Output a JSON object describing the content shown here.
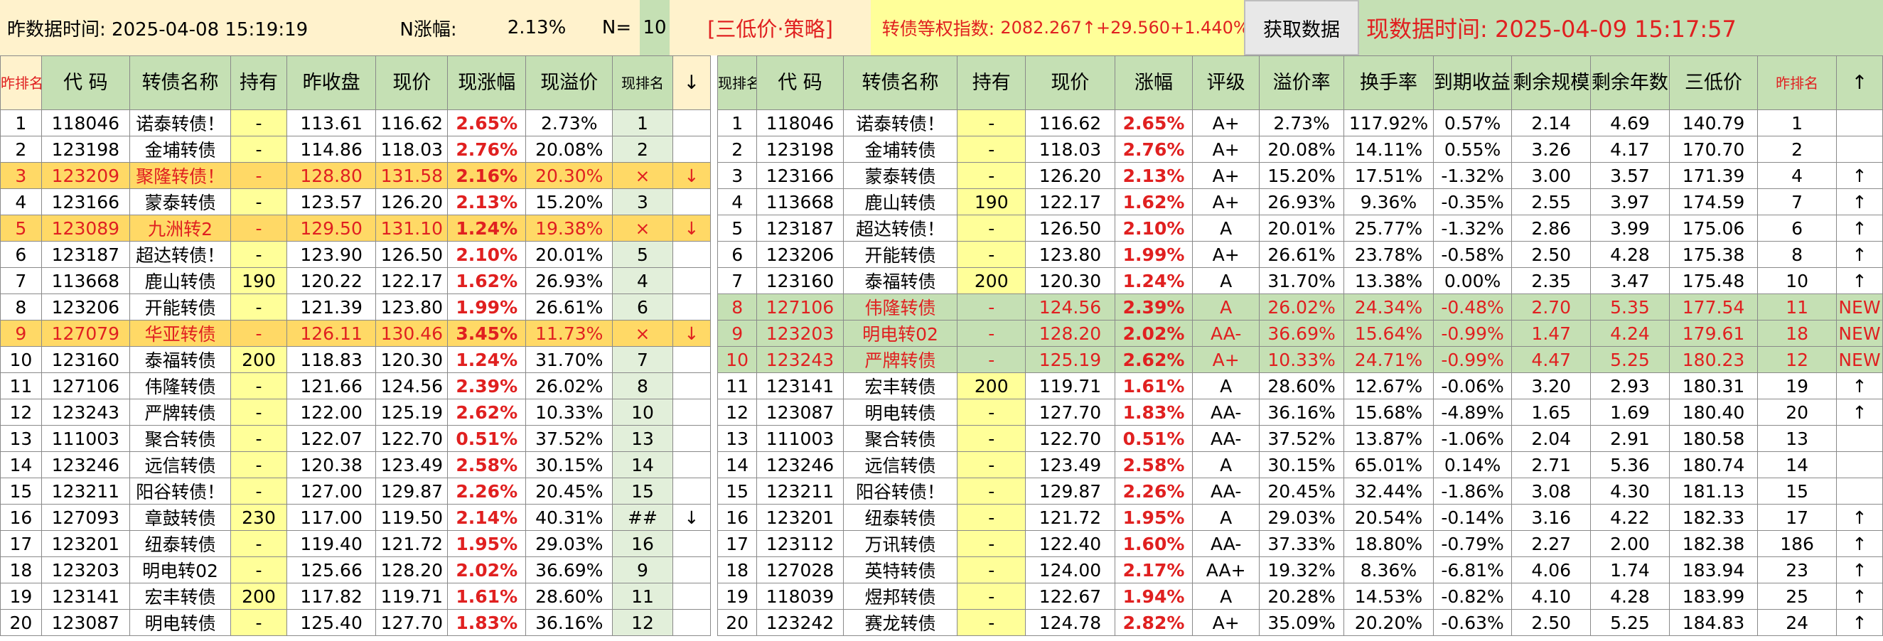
{
  "toolbar": {
    "prev_time_label": "昨数据时间: 2025-04-08 15:19:19",
    "n_change_label": "N涨幅:",
    "n_change_value": "2.13%",
    "n_label": "N=",
    "n_value": "10",
    "strategy_label": "[三低价·策略]",
    "index_label": "转债等权指数:",
    "index_value": "2082.267↑+29.560+1.440%",
    "fetch_button": "获取数据",
    "curr_time_label": "现数据时间: 2025-04-09 15:17:57"
  },
  "colors": {
    "up": "#e02020",
    "header_bg": "#c5e0b4",
    "hold_bg": "#ffff99",
    "drop_row_bg": "#ffd966"
  },
  "left_table": {
    "headers": {
      "rank": "昨排名",
      "code": "代 码",
      "name": "转债名称",
      "hold": "持有",
      "prev_close": "昨收盘",
      "price": "现价",
      "change": "现涨幅",
      "premium": "现溢价",
      "now_rank": "现排名",
      "arrow": "↓"
    },
    "rows": [
      {
        "rank": "1",
        "code": "118046",
        "name": "诺泰转债！",
        "hold": "-",
        "prev": "113.61",
        "price": "116.62",
        "chg": "2.65%",
        "prem": "2.73%",
        "now": "1",
        "arrow": "",
        "style": ""
      },
      {
        "rank": "2",
        "code": "123198",
        "name": "金埔转债",
        "hold": "-",
        "prev": "114.86",
        "price": "118.03",
        "chg": "2.76%",
        "prem": "20.08%",
        "now": "2",
        "arrow": "",
        "style": ""
      },
      {
        "rank": "3",
        "code": "123209",
        "name": "聚隆转债！",
        "hold": "-",
        "prev": "128.80",
        "price": "131.58",
        "chg": "2.16%",
        "prem": "20.30%",
        "now": "×",
        "arrow": "↓",
        "style": "drop"
      },
      {
        "rank": "4",
        "code": "123166",
        "name": "蒙泰转债",
        "hold": "-",
        "prev": "123.57",
        "price": "126.20",
        "chg": "2.13%",
        "prem": "15.20%",
        "now": "3",
        "arrow": "",
        "style": ""
      },
      {
        "rank": "5",
        "code": "123089",
        "name": "九洲转2",
        "hold": "-",
        "prev": "129.50",
        "price": "131.10",
        "chg": "1.24%",
        "prem": "19.38%",
        "now": "×",
        "arrow": "↓",
        "style": "drop"
      },
      {
        "rank": "6",
        "code": "123187",
        "name": "超达转债！",
        "hold": "-",
        "prev": "123.90",
        "price": "126.50",
        "chg": "2.10%",
        "prem": "20.01%",
        "now": "5",
        "arrow": "",
        "style": ""
      },
      {
        "rank": "7",
        "code": "113668",
        "name": "鹿山转债",
        "hold": "190",
        "prev": "120.22",
        "price": "122.17",
        "chg": "1.62%",
        "prem": "26.93%",
        "now": "4",
        "arrow": "",
        "style": ""
      },
      {
        "rank": "8",
        "code": "123206",
        "name": "开能转债",
        "hold": "-",
        "prev": "121.39",
        "price": "123.80",
        "chg": "1.99%",
        "prem": "26.61%",
        "now": "6",
        "arrow": "",
        "style": ""
      },
      {
        "rank": "9",
        "code": "127079",
        "name": "华亚转债",
        "hold": "-",
        "prev": "126.11",
        "price": "130.46",
        "chg": "3.45%",
        "prem": "11.73%",
        "now": "×",
        "arrow": "↓",
        "style": "drop"
      },
      {
        "rank": "10",
        "code": "123160",
        "name": "泰福转债",
        "hold": "200",
        "prev": "118.83",
        "price": "120.30",
        "chg": "1.24%",
        "prem": "31.70%",
        "now": "7",
        "arrow": "",
        "style": ""
      },
      {
        "rank": "11",
        "code": "127106",
        "name": "伟隆转债",
        "hold": "-",
        "prev": "121.66",
        "price": "124.56",
        "chg": "2.39%",
        "prem": "26.02%",
        "now": "8",
        "arrow": "",
        "style": ""
      },
      {
        "rank": "12",
        "code": "123243",
        "name": "严牌转债",
        "hold": "-",
        "prev": "122.00",
        "price": "125.19",
        "chg": "2.62%",
        "prem": "10.33%",
        "now": "10",
        "arrow": "",
        "style": ""
      },
      {
        "rank": "13",
        "code": "111003",
        "name": "聚合转债",
        "hold": "-",
        "prev": "122.07",
        "price": "122.70",
        "chg": "0.51%",
        "prem": "37.52%",
        "now": "13",
        "arrow": "",
        "style": ""
      },
      {
        "rank": "14",
        "code": "123246",
        "name": "远信转债",
        "hold": "-",
        "prev": "120.38",
        "price": "123.49",
        "chg": "2.58%",
        "prem": "30.15%",
        "now": "14",
        "arrow": "",
        "style": ""
      },
      {
        "rank": "15",
        "code": "123211",
        "name": "阳谷转债！",
        "hold": "-",
        "prev": "127.00",
        "price": "129.87",
        "chg": "2.26%",
        "prem": "20.45%",
        "now": "15",
        "arrow": "",
        "style": ""
      },
      {
        "rank": "16",
        "code": "127093",
        "name": "章鼓转债",
        "hold": "230",
        "prev": "117.00",
        "price": "119.50",
        "chg": "2.14%",
        "prem": "40.31%",
        "now": "##",
        "arrow": "↓",
        "style": ""
      },
      {
        "rank": "17",
        "code": "123201",
        "name": "纽泰转债",
        "hold": "-",
        "prev": "119.40",
        "price": "121.72",
        "chg": "1.95%",
        "prem": "29.03%",
        "now": "16",
        "arrow": "",
        "style": ""
      },
      {
        "rank": "18",
        "code": "123203",
        "name": "明电转02",
        "hold": "-",
        "prev": "125.66",
        "price": "128.20",
        "chg": "2.02%",
        "prem": "36.69%",
        "now": "9",
        "arrow": "",
        "style": ""
      },
      {
        "rank": "19",
        "code": "123141",
        "name": "宏丰转债",
        "hold": "200",
        "prev": "117.82",
        "price": "119.71",
        "chg": "1.61%",
        "prem": "28.60%",
        "now": "11",
        "arrow": "",
        "style": ""
      },
      {
        "rank": "20",
        "code": "123087",
        "name": "明电转债",
        "hold": "-",
        "prev": "125.40",
        "price": "127.70",
        "chg": "1.83%",
        "prem": "36.16%",
        "now": "12",
        "arrow": "",
        "style": ""
      }
    ]
  },
  "right_table": {
    "headers": {
      "rank": "现排名",
      "code": "代 码",
      "name": "转债名称",
      "hold": "持有",
      "price": "现价",
      "change": "涨幅",
      "rating": "评级",
      "premium": "溢价率",
      "turnover": "换手率",
      "ytm": "到期收益率",
      "scale": "剩余规模",
      "years": "剩余年数",
      "triple_low": "三低价",
      "prev_rank": "昨排名",
      "arrow": "↑"
    },
    "rows": [
      {
        "rank": "1",
        "code": "118046",
        "name": "诺泰转债！",
        "hold": "-",
        "price": "116.62",
        "chg": "2.65%",
        "rating": "A+",
        "prem": "2.73%",
        "turn": "117.92%",
        "ytm": "0.57%",
        "scale": "2.14",
        "years": "4.69",
        "tl": "140.79",
        "prev": "1",
        "arrow": "",
        "style": ""
      },
      {
        "rank": "2",
        "code": "123198",
        "name": "金埔转债",
        "hold": "-",
        "price": "118.03",
        "chg": "2.76%",
        "rating": "A+",
        "prem": "20.08%",
        "turn": "14.11%",
        "ytm": "0.55%",
        "scale": "3.26",
        "years": "4.17",
        "tl": "170.70",
        "prev": "2",
        "arrow": "",
        "style": ""
      },
      {
        "rank": "3",
        "code": "123166",
        "name": "蒙泰转债",
        "hold": "-",
        "price": "126.20",
        "chg": "2.13%",
        "rating": "A+",
        "prem": "15.20%",
        "turn": "17.51%",
        "ytm": "-1.32%",
        "scale": "3.00",
        "years": "3.57",
        "tl": "171.39",
        "prev": "4",
        "arrow": "↑",
        "style": ""
      },
      {
        "rank": "4",
        "code": "113668",
        "name": "鹿山转债",
        "hold": "190",
        "price": "122.17",
        "chg": "1.62%",
        "rating": "A+",
        "prem": "26.93%",
        "turn": "9.36%",
        "ytm": "-0.35%",
        "scale": "2.55",
        "years": "3.97",
        "tl": "174.59",
        "prev": "7",
        "arrow": "↑",
        "style": ""
      },
      {
        "rank": "5",
        "code": "123187",
        "name": "超达转债！",
        "hold": "-",
        "price": "126.50",
        "chg": "2.10%",
        "rating": "A",
        "prem": "20.01%",
        "turn": "25.77%",
        "ytm": "-1.32%",
        "scale": "2.86",
        "years": "3.99",
        "tl": "175.06",
        "prev": "6",
        "arrow": "↑",
        "style": ""
      },
      {
        "rank": "6",
        "code": "123206",
        "name": "开能转债",
        "hold": "-",
        "price": "123.80",
        "chg": "1.99%",
        "rating": "A+",
        "prem": "26.61%",
        "turn": "23.78%",
        "ytm": "-0.58%",
        "scale": "2.50",
        "years": "4.28",
        "tl": "175.38",
        "prev": "8",
        "arrow": "↑",
        "style": ""
      },
      {
        "rank": "7",
        "code": "123160",
        "name": "泰福转债",
        "hold": "200",
        "price": "120.30",
        "chg": "1.24%",
        "rating": "A",
        "prem": "31.70%",
        "turn": "13.38%",
        "ytm": "0.00%",
        "scale": "2.35",
        "years": "3.47",
        "tl": "175.48",
        "prev": "10",
        "arrow": "↑",
        "style": ""
      },
      {
        "rank": "8",
        "code": "127106",
        "name": "伟隆转债",
        "hold": "-",
        "price": "124.56",
        "chg": "2.39%",
        "rating": "A",
        "prem": "26.02%",
        "turn": "24.34%",
        "ytm": "-0.48%",
        "scale": "2.70",
        "years": "5.35",
        "tl": "177.54",
        "prev": "11",
        "arrow": "NEW",
        "style": "newin"
      },
      {
        "rank": "9",
        "code": "123203",
        "name": "明电转02",
        "hold": "-",
        "price": "128.20",
        "chg": "2.02%",
        "rating": "AA-",
        "prem": "36.69%",
        "turn": "15.64%",
        "ytm": "-0.99%",
        "scale": "1.47",
        "years": "4.24",
        "tl": "179.61",
        "prev": "18",
        "arrow": "NEW",
        "style": "newin"
      },
      {
        "rank": "10",
        "code": "123243",
        "name": "严牌转债",
        "hold": "-",
        "price": "125.19",
        "chg": "2.62%",
        "rating": "A+",
        "prem": "10.33%",
        "turn": "24.71%",
        "ytm": "-0.99%",
        "scale": "4.47",
        "years": "5.25",
        "tl": "180.23",
        "prev": "12",
        "arrow": "NEW",
        "style": "newin"
      },
      {
        "rank": "11",
        "code": "123141",
        "name": "宏丰转债",
        "hold": "200",
        "price": "119.71",
        "chg": "1.61%",
        "rating": "A",
        "prem": "28.60%",
        "turn": "12.67%",
        "ytm": "-0.06%",
        "scale": "3.20",
        "years": "2.93",
        "tl": "180.31",
        "prev": "19",
        "arrow": "↑",
        "style": ""
      },
      {
        "rank": "12",
        "code": "123087",
        "name": "明电转债",
        "hold": "-",
        "price": "127.70",
        "chg": "1.83%",
        "rating": "AA-",
        "prem": "36.16%",
        "turn": "15.68%",
        "ytm": "-4.89%",
        "scale": "1.65",
        "years": "1.69",
        "tl": "180.40",
        "prev": "20",
        "arrow": "↑",
        "style": ""
      },
      {
        "rank": "13",
        "code": "111003",
        "name": "聚合转债",
        "hold": "-",
        "price": "122.70",
        "chg": "0.51%",
        "rating": "AA-",
        "prem": "37.52%",
        "turn": "13.87%",
        "ytm": "-1.06%",
        "scale": "2.04",
        "years": "2.91",
        "tl": "180.58",
        "prev": "13",
        "arrow": "",
        "style": ""
      },
      {
        "rank": "14",
        "code": "123246",
        "name": "远信转债",
        "hold": "-",
        "price": "123.49",
        "chg": "2.58%",
        "rating": "A",
        "prem": "30.15%",
        "turn": "65.01%",
        "ytm": "0.14%",
        "scale": "2.71",
        "years": "5.36",
        "tl": "180.74",
        "prev": "14",
        "arrow": "",
        "style": ""
      },
      {
        "rank": "15",
        "code": "123211",
        "name": "阳谷转债！",
        "hold": "-",
        "price": "129.87",
        "chg": "2.26%",
        "rating": "AA-",
        "prem": "20.45%",
        "turn": "32.44%",
        "ytm": "-1.86%",
        "scale": "3.08",
        "years": "4.30",
        "tl": "181.13",
        "prev": "15",
        "arrow": "",
        "style": ""
      },
      {
        "rank": "16",
        "code": "123201",
        "name": "纽泰转债",
        "hold": "-",
        "price": "121.72",
        "chg": "1.95%",
        "rating": "A",
        "prem": "29.03%",
        "turn": "20.54%",
        "ytm": "-0.14%",
        "scale": "3.16",
        "years": "4.22",
        "tl": "182.33",
        "prev": "17",
        "arrow": "↑",
        "style": ""
      },
      {
        "rank": "17",
        "code": "123112",
        "name": "万讯转债",
        "hold": "-",
        "price": "122.40",
        "chg": "1.60%",
        "rating": "AA-",
        "prem": "37.33%",
        "turn": "18.80%",
        "ytm": "-0.79%",
        "scale": "2.27",
        "years": "2.00",
        "tl": "182.38",
        "prev": "186",
        "arrow": "↑",
        "style": ""
      },
      {
        "rank": "18",
        "code": "127028",
        "name": "英特转债",
        "hold": "-",
        "price": "124.00",
        "chg": "2.17%",
        "rating": "AA+",
        "prem": "19.32%",
        "turn": "8.36%",
        "ytm": "-6.81%",
        "scale": "4.06",
        "years": "1.74",
        "tl": "183.94",
        "prev": "23",
        "arrow": "↑",
        "style": ""
      },
      {
        "rank": "19",
        "code": "118039",
        "name": "煜邦转债",
        "hold": "-",
        "price": "122.67",
        "chg": "1.94%",
        "rating": "A",
        "prem": "20.28%",
        "turn": "14.53%",
        "ytm": "-0.82%",
        "scale": "4.10",
        "years": "4.28",
        "tl": "183.99",
        "prev": "25",
        "arrow": "↑",
        "style": ""
      },
      {
        "rank": "20",
        "code": "123242",
        "name": "赛龙转债",
        "hold": "-",
        "price": "124.78",
        "chg": "2.82%",
        "rating": "A+",
        "prem": "35.09%",
        "turn": "20.20%",
        "ytm": "-0.63%",
        "scale": "2.50",
        "years": "5.25",
        "tl": "184.83",
        "prev": "24",
        "arrow": "↑",
        "style": ""
      }
    ]
  }
}
